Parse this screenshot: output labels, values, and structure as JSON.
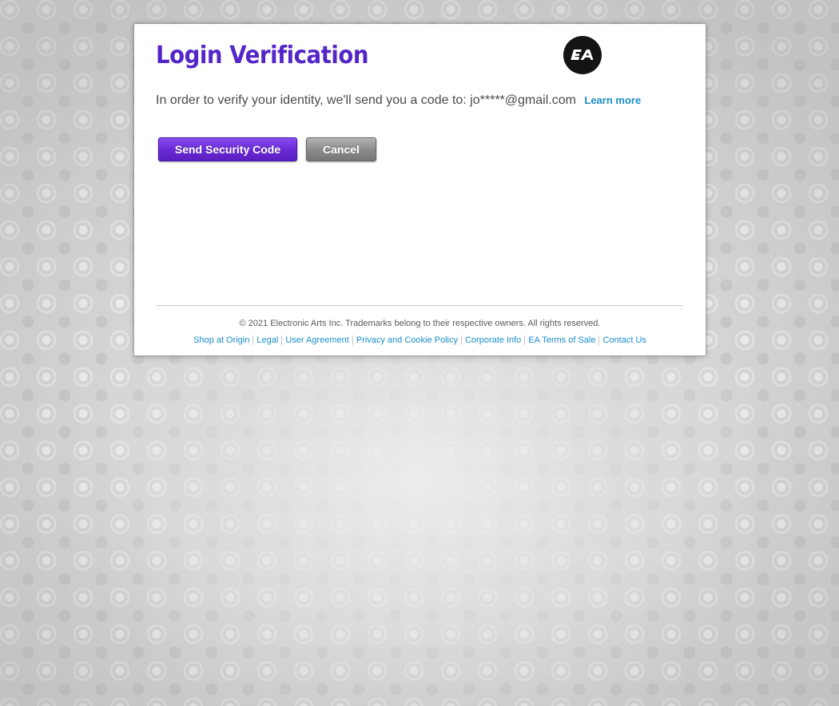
{
  "page": {
    "title": "Login Verification"
  },
  "logo": {
    "icon": "ea-logo-icon",
    "text": "EA"
  },
  "intro": {
    "text": "In order to verify your identity, we'll send you a code to: jo*****@gmail.com",
    "learn_more_label": "Learn more"
  },
  "buttons": {
    "send_label": "Send Security Code",
    "cancel_label": "Cancel"
  },
  "footer": {
    "copyright": "© 2021 Electronic Arts Inc. Trademarks belong to their respective owners. All rights reserved.",
    "links": [
      "Shop at Origin",
      "Legal",
      "User Agreement",
      "Privacy and Cookie Policy",
      "Corporate Info",
      "EA Terms of Sale",
      "Contact Us"
    ]
  },
  "colors": {
    "title": "#5426c8",
    "link": "#1a8ec9",
    "primary_button": "#6a2ad6",
    "secondary_button": "#8c8c8c"
  }
}
